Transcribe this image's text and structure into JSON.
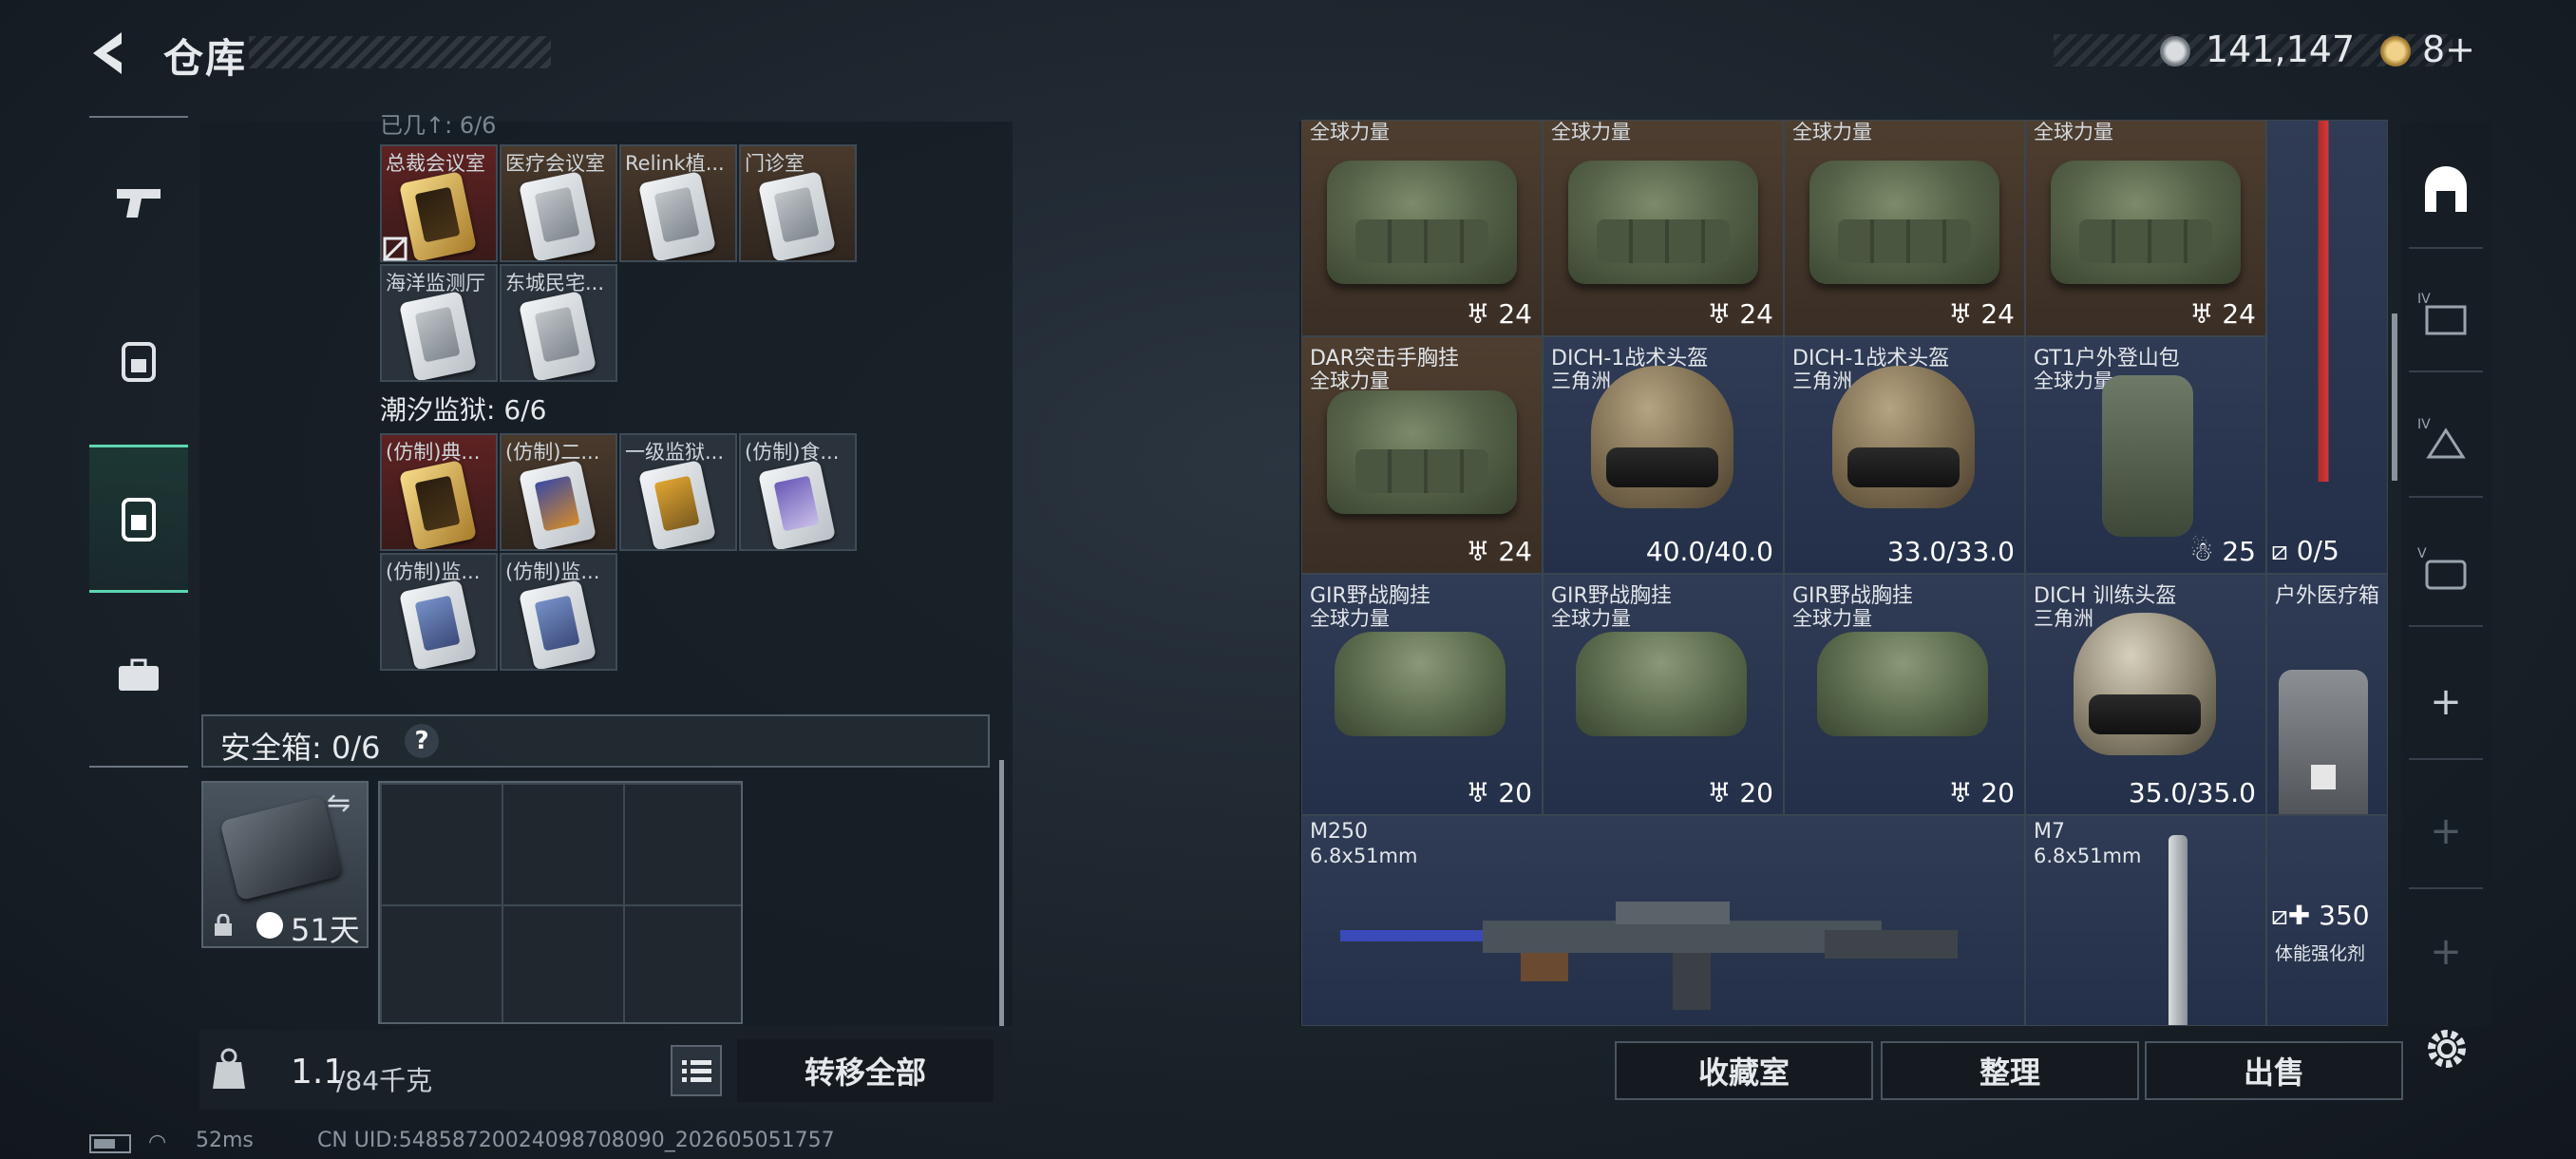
{
  "header": {
    "title": "仓库",
    "currency1": "141,147",
    "currency2": "8+"
  },
  "left_nav": {
    "items": [
      {
        "name": "weapons",
        "icon": "pistol-icon"
      },
      {
        "name": "gear",
        "icon": "backpack-lock-icon"
      },
      {
        "name": "keycards",
        "icon": "keycard-icon",
        "active": true
      },
      {
        "name": "supplies",
        "icon": "briefcase-icon"
      }
    ]
  },
  "keycards": {
    "partial_header": "已几↑: 6/6",
    "row1": [
      {
        "label": "总裁会议室",
        "style": "red",
        "card": "gold"
      },
      {
        "label": "医疗会议室",
        "style": "brown",
        "card": "white"
      },
      {
        "label": "Relink植...",
        "style": "brown",
        "card": "white"
      },
      {
        "label": "门诊室",
        "style": "brown",
        "card": "white"
      }
    ],
    "row2": [
      {
        "label": "海洋监测厅",
        "style": "grey",
        "card": "white"
      },
      {
        "label": "东城民宅...",
        "style": "grey",
        "card": "white"
      }
    ],
    "prison_title": "潮汐监狱: 6/6",
    "row3": [
      {
        "label": "(仿制)典...",
        "style": "red",
        "card": "gold"
      },
      {
        "label": "(仿制)二...",
        "style": "brown",
        "card": "orange"
      },
      {
        "label": "一级监狱...",
        "style": "grey",
        "card": "goldbar"
      },
      {
        "label": "(仿制)食...",
        "style": "grey",
        "card": "purple"
      }
    ],
    "row4": [
      {
        "label": "(仿制)监...",
        "style": "grey",
        "card": "blue"
      },
      {
        "label": "(仿制)监...",
        "style": "grey",
        "card": "blue"
      }
    ]
  },
  "safe_box": {
    "label": "安全箱: 0/6",
    "help": "?",
    "days": "51天"
  },
  "weight": {
    "current": "1.1",
    "max": "/84千克"
  },
  "transfer_all": "转移全部",
  "storage": {
    "row1": [
      {
        "top": "全球力量",
        "count": "24"
      },
      {
        "top": "全球力量",
        "count": "24"
      },
      {
        "top": "全球力量",
        "count": "24"
      },
      {
        "top": "全球力量",
        "count": "24"
      }
    ],
    "row2": [
      {
        "name": "DAR突击手胸挂",
        "sub": "全球力量",
        "count": "24"
      },
      {
        "name": "DICH-1战术头盔",
        "sub": "三角洲",
        "count": "40.0/40.0"
      },
      {
        "name": "DICH-1战术头盔",
        "sub": "三角洲",
        "count": "33.0/33.0"
      },
      {
        "name": "GT1户外登山包",
        "sub": "全球力量",
        "count": "25"
      }
    ],
    "sniper_count": "0/5",
    "row3": [
      {
        "name": "GIR野战胸挂",
        "sub": "全球力量",
        "count": "20"
      },
      {
        "name": "GIR野战胸挂",
        "sub": "全球力量",
        "count": "20"
      },
      {
        "name": "GIR野战胸挂",
        "sub": "全球力量",
        "count": "20"
      },
      {
        "name": "DICH 训练头盔",
        "sub": "三角洲",
        "count": "35.0/35.0"
      }
    ],
    "med_name": "户外医疗箱",
    "row4": {
      "mg_name": "M250",
      "mg_sub": "6.8x51mm",
      "mag_name": "M7",
      "mag_sub": "6.8x51mm",
      "stim_count": "350",
      "stim_name": "体能强化剂"
    }
  },
  "actions": {
    "collection": "收藏室",
    "sort": "整理",
    "sell": "出售"
  },
  "status_bar": {
    "ping": "52ms",
    "uid": "CN UID:5485872002409870809​0_202605051757"
  }
}
